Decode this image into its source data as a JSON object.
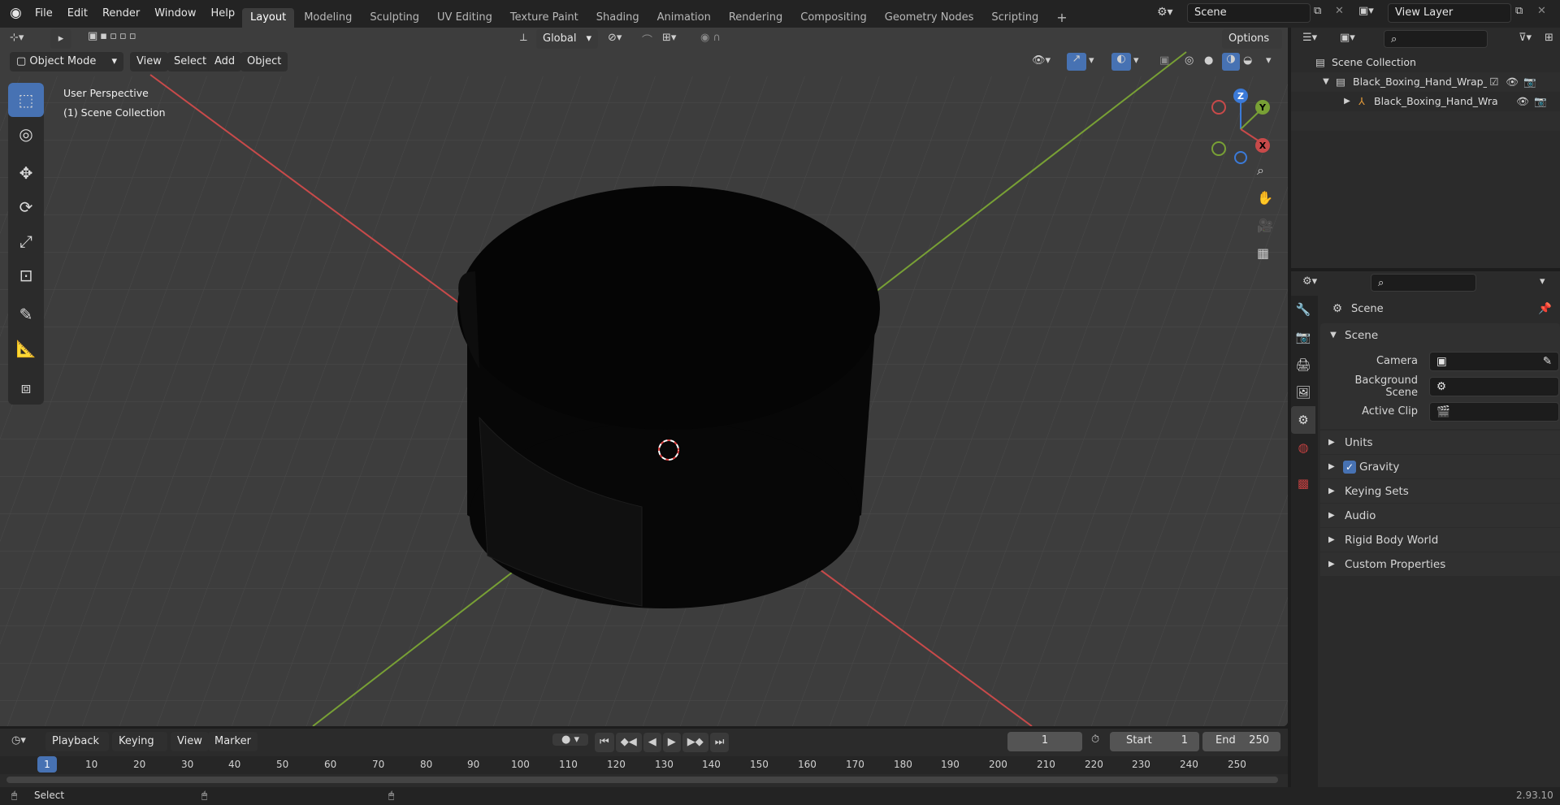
{
  "topbar": {
    "menu": [
      "File",
      "Edit",
      "Render",
      "Window",
      "Help"
    ],
    "workspaces": [
      "Layout",
      "Modeling",
      "Sculpting",
      "UV Editing",
      "Texture Paint",
      "Shading",
      "Animation",
      "Rendering",
      "Compositing",
      "Geometry Nodes",
      "Scripting"
    ],
    "active_workspace": "Layout",
    "add_tab": "+",
    "scene_name": "Scene",
    "view_layer": "View Layer"
  },
  "viewport": {
    "transform_orientation": "Global",
    "options": "Options",
    "mode": "Object Mode",
    "menu": [
      "View",
      "Select",
      "Add",
      "Object"
    ],
    "overlay_line1": "User Perspective",
    "overlay_line2": "(1) Scene Collection",
    "gizmo": {
      "x": "X",
      "y": "Y",
      "z": "Z"
    },
    "colors": {
      "x_axis": "#c84a4a",
      "y_axis": "#78a035",
      "bg": "#3d3d3d",
      "active_tool": "#4772b3"
    }
  },
  "outliner": {
    "root": "Scene Collection",
    "rows": [
      {
        "label": "Black_Boxing_Hand_Wrap_Ro"
      },
      {
        "label": "Black_Boxing_Hand_Wra"
      }
    ]
  },
  "properties": {
    "context": "Scene",
    "panel": "Scene",
    "camera_label": "Camera",
    "background_scene_label": "Background Scene",
    "active_clip_label": "Active Clip",
    "sections": [
      "Units",
      "Gravity",
      "Keying Sets",
      "Audio",
      "Rigid Body World",
      "Custom Properties"
    ],
    "gravity_checked": true
  },
  "timeline": {
    "menu": [
      "Playback",
      "Keying",
      "View",
      "Marker"
    ],
    "current_frame": "1",
    "start_label": "Start",
    "start": "1",
    "end_label": "End",
    "end": "250",
    "ruler": [
      "1",
      "10",
      "20",
      "30",
      "40",
      "50",
      "60",
      "70",
      "80",
      "90",
      "100",
      "110",
      "120",
      "130",
      "140",
      "150",
      "160",
      "170",
      "180",
      "190",
      "200",
      "210",
      "220",
      "230",
      "240",
      "250"
    ]
  },
  "status": {
    "select": "Select",
    "version": "2.93.10"
  }
}
